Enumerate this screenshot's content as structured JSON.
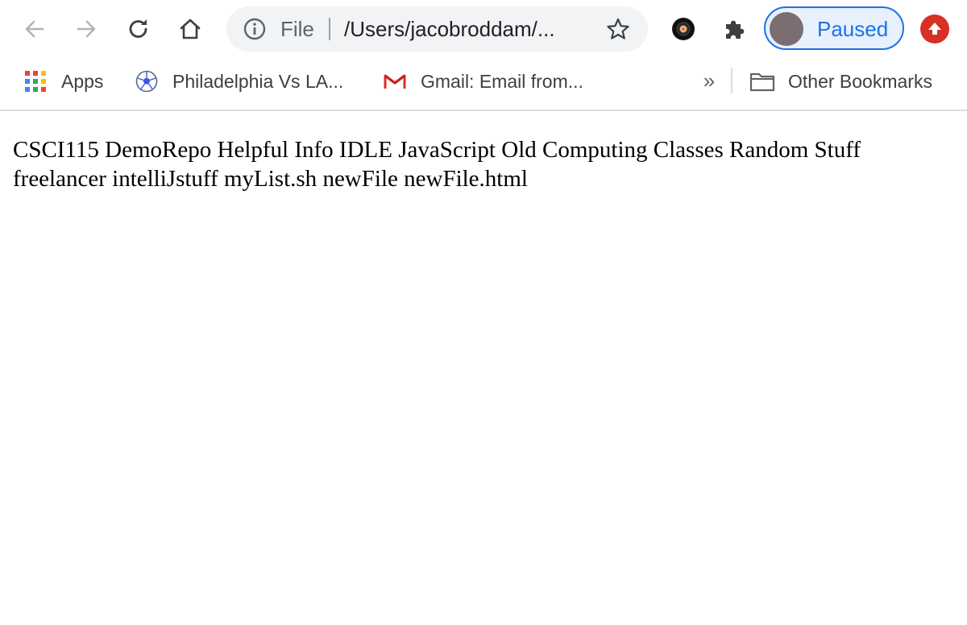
{
  "browser": {
    "omnibox": {
      "scheme_label": "File",
      "url_display": "/Users/jacobroddam/..."
    },
    "profile": {
      "label": "Paused"
    },
    "colors": {
      "accent": "#1a73e8",
      "update_badge": "#d93025"
    },
    "icons": [
      "back-arrow-icon",
      "forward-arrow-icon",
      "reload-icon",
      "home-icon",
      "info-icon",
      "star-icon",
      "extension-icon",
      "puzzle-icon",
      "update-arrow-icon"
    ]
  },
  "bookmarks": {
    "items": [
      {
        "label": "Apps",
        "icon": "apps-grid-icon"
      },
      {
        "label": "Philadelphia Vs LA...",
        "icon": "soccer-ball-icon"
      },
      {
        "label": "Gmail: Email from...",
        "icon": "gmail-icon"
      }
    ],
    "overflow_label": "»",
    "other": {
      "label": "Other Bookmarks",
      "icon": "folder-icon"
    }
  },
  "page": {
    "entries": [
      "CSCI115",
      "DemoRepo",
      "Helpful Info",
      "IDLE",
      "JavaScript",
      "Old Computing Classes",
      "Random Stuff",
      "freelancer",
      "intelliJstuff",
      "myList.sh",
      "newFile",
      "newFile.html"
    ]
  }
}
